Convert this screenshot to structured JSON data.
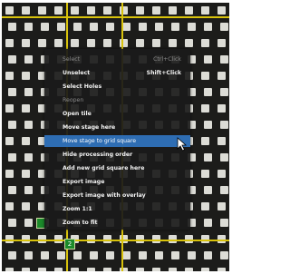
{
  "context_menu": {
    "items": [
      {
        "label": "Select",
        "shortcut": "Ctrl+Click",
        "state": "disabled"
      },
      {
        "label": "Unselect",
        "shortcut": "Shift+Click",
        "state": "normal"
      },
      {
        "label": "Select Holes",
        "shortcut": "",
        "state": "normal"
      },
      {
        "label": "Reopen",
        "shortcut": "",
        "state": "disabled"
      },
      {
        "label": "Open tile",
        "shortcut": "",
        "state": "normal"
      },
      {
        "label": "Move stage here",
        "shortcut": "",
        "state": "normal"
      },
      {
        "label": "Move stage to grid square",
        "shortcut": "",
        "state": "highlighted"
      },
      {
        "label": "Hide processing order",
        "shortcut": "",
        "state": "normal"
      },
      {
        "label": "Add new grid square here",
        "shortcut": "",
        "state": "normal"
      },
      {
        "label": "Export image",
        "shortcut": "",
        "state": "normal"
      },
      {
        "label": "Export image with overlay",
        "shortcut": "",
        "state": "normal"
      },
      {
        "label": "Zoom 1:1",
        "shortcut": "",
        "state": "normal"
      },
      {
        "label": "Zoom to fit",
        "shortcut": "",
        "state": "normal"
      }
    ]
  },
  "grid_view": {
    "tile_label": "2",
    "hole_color": "#dcdcd6",
    "grid_line_color": "#d8c20b",
    "highlight_color": "#2e6db3",
    "tile_box_color": "#1b8a2a"
  }
}
